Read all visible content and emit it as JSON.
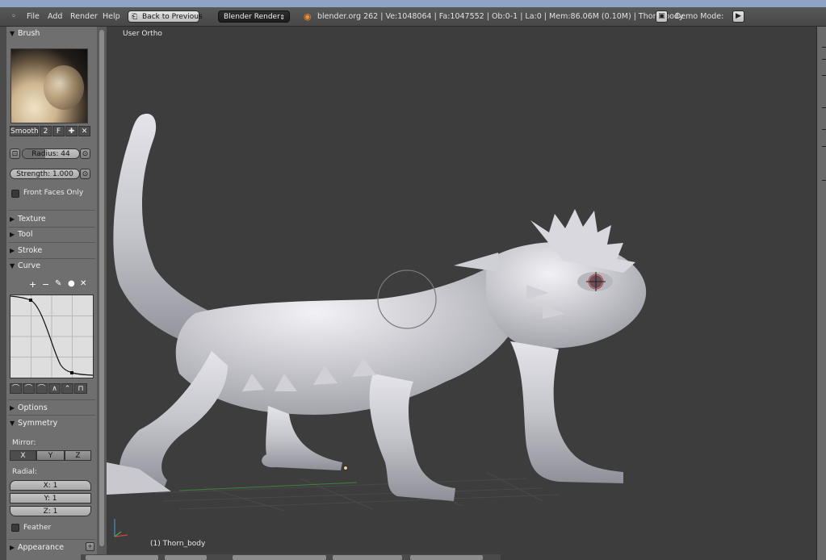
{
  "menubar": {
    "items": [
      "File",
      "Add",
      "Render",
      "Help"
    ],
    "back_button": "Back to Previous",
    "render_engine": "Blender Render",
    "stats": "blender.org 262 | Ve:1048064 | Fa:1047552 | Ob:0-1 | La:0 | Mem:86.06M (0.10M) | Thorn_body",
    "demo_mode": "Demo Mode:"
  },
  "tool_shelf": {
    "brush_header": "Brush",
    "brush_name": "Smooth",
    "brush_users": "2",
    "fake_user": "F",
    "radius": "Radius: 44",
    "strength": "Strength: 1.000",
    "front_faces_only": "Front Faces Only",
    "panels_collapsed": [
      "Texture",
      "Tool",
      "Stroke"
    ],
    "curve_header": "Curve",
    "options": "Options",
    "symmetry_header": "Symmetry",
    "mirror_label": "Mirror:",
    "mirror_axes": [
      "X",
      "Y",
      "Z"
    ],
    "radial_label": "Radial:",
    "radial": [
      "X: 1",
      "Y: 1",
      "Z: 1"
    ],
    "feather": "Feather",
    "appearance": "Appearance"
  },
  "viewport": {
    "view_name": "User Ortho",
    "object_label": "(1) Thorn_body"
  },
  "colors": {
    "viewport_bg": "#3d3d3d",
    "panel_bg": "#6f6f6f",
    "header_bg": "#4f4f4f",
    "mesh": "#c9c9cf"
  }
}
